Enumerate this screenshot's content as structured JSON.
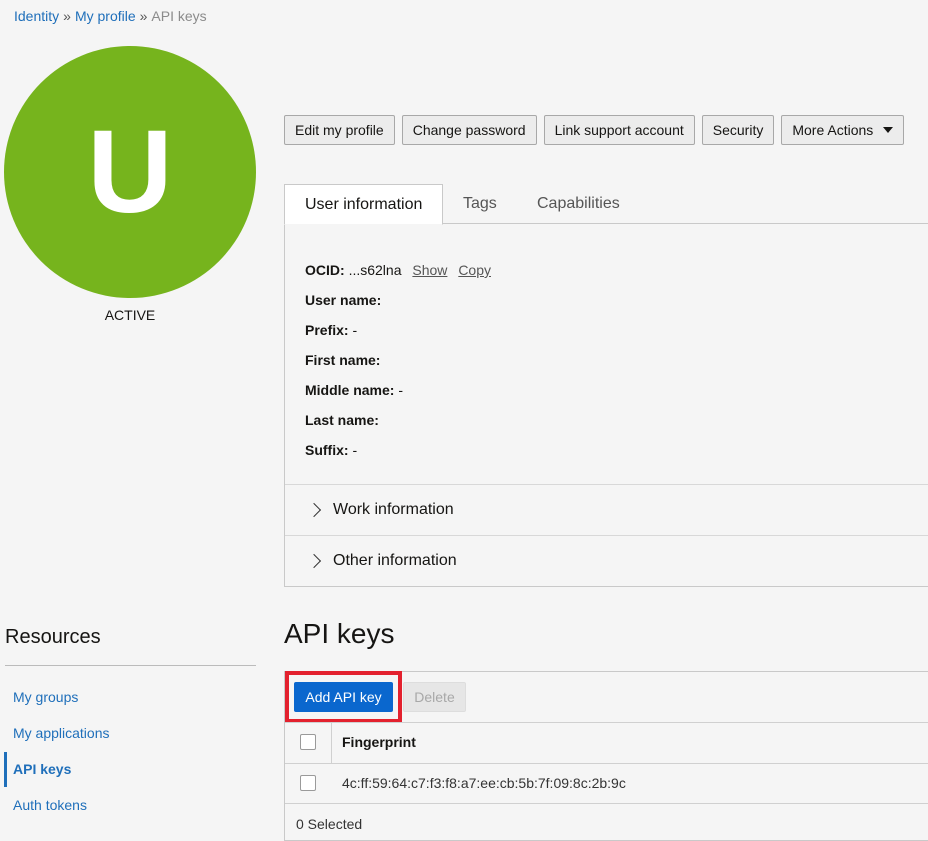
{
  "breadcrumb": {
    "identity": "Identity",
    "sep1": "»",
    "profile": "My profile",
    "sep2": "»",
    "current": "API keys"
  },
  "avatar": {
    "letter": "U",
    "status": "ACTIVE",
    "color": "#76b41d"
  },
  "actions": {
    "edit_profile": "Edit my profile",
    "change_password": "Change password",
    "link_support": "Link support account",
    "security": "Security",
    "more_actions": "More Actions"
  },
  "tabs": {
    "user_info": "User information",
    "tags": "Tags",
    "capabilities": "Capabilities"
  },
  "user_info": {
    "ocid_label": "OCID:",
    "ocid_value": "...s62lna",
    "show": "Show",
    "copy": "Copy",
    "user_name_label": "User name:",
    "user_name_value": "",
    "prefix_label": "Prefix:",
    "prefix_value": "-",
    "first_name_label": "First name:",
    "first_name_value": "",
    "middle_name_label": "Middle name:",
    "middle_name_value": "-",
    "last_name_label": "Last name:",
    "last_name_value": "",
    "suffix_label": "Suffix:",
    "suffix_value": "-"
  },
  "sections": {
    "work_info": "Work information",
    "other_info": "Other information"
  },
  "resources": {
    "title": "Resources",
    "items": [
      "My groups",
      "My applications",
      "API keys",
      "Auth tokens"
    ]
  },
  "api_keys": {
    "title": "API keys",
    "add_button": "Add API key",
    "delete_button": "Delete",
    "column_fingerprint": "Fingerprint",
    "rows": [
      {
        "fingerprint": "4c:ff:59:64:c7:f3:f8:a7:ee:cb:5b:7f:09:8c:2b:9c"
      }
    ],
    "selected_text": "0 Selected"
  },
  "colors": {
    "link": "#1f6fba",
    "primary_button": "#0a67ce",
    "highlight": "#e3212e"
  }
}
